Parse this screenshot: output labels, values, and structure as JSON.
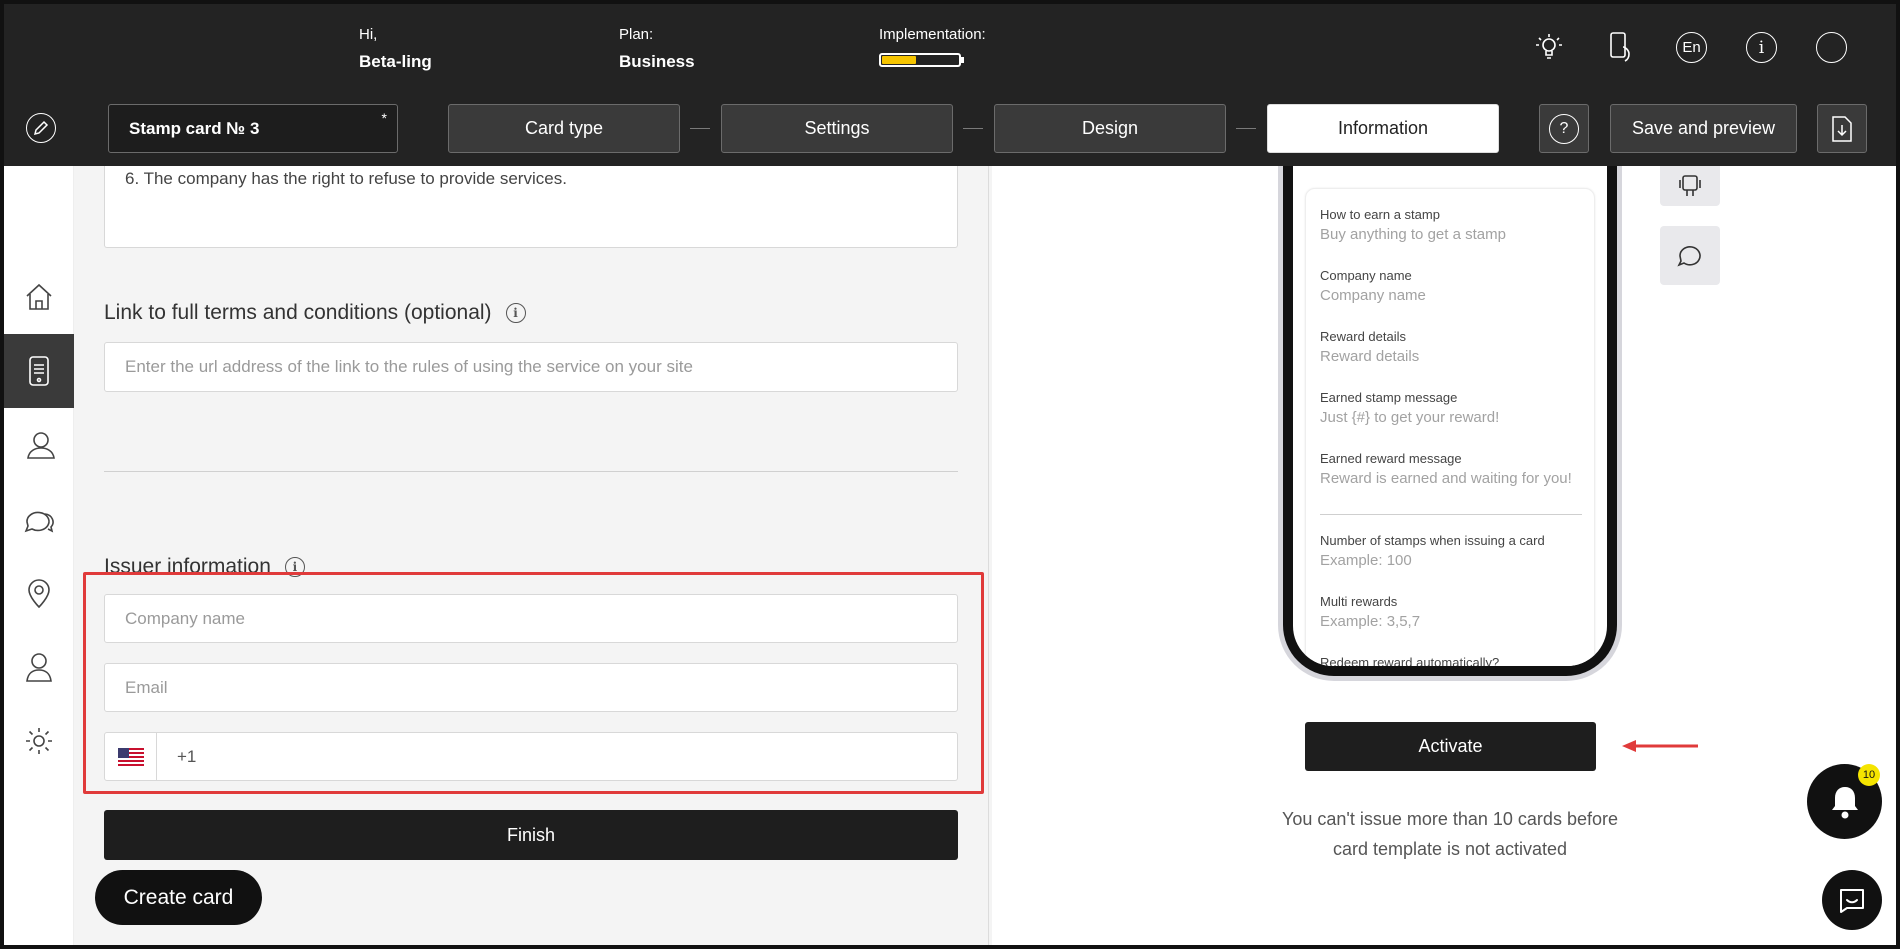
{
  "header": {
    "greeting": "Hi,",
    "user_name": "Beta-ling",
    "plan_label": "Plan:",
    "plan_value": "Business",
    "implementation_label": "Implementation:",
    "implementation_progress": 0.45,
    "language": "En",
    "icons": [
      "lightbulb-icon",
      "phone-touch-icon",
      "language-icon",
      "info-icon",
      "profile-circle-icon"
    ]
  },
  "toolbar": {
    "card_name": "Stamp card № 3",
    "unsaved_marker": "*",
    "steps": [
      "Card type",
      "Settings",
      "Design",
      "Information"
    ],
    "active_step": "Information",
    "save_preview": "Save and preview"
  },
  "sidebar": {
    "items": [
      "home-icon",
      "card-device-icon",
      "users-icon",
      "chat-icon",
      "location-icon",
      "profile-icon",
      "settings-icon"
    ],
    "active": "card-device-icon"
  },
  "form": {
    "terms_text": "6. The company has the right to refuse to provide services.",
    "link_heading": "Link to full terms and conditions (optional)",
    "link_placeholder": "Enter the url address of the link to the rules of using the service on your site",
    "issuer_heading": "Issuer information",
    "company_placeholder": "Company name",
    "email_placeholder": "Email",
    "phone_code": "+1",
    "finish_label": "Finish",
    "create_card_label": "Create card"
  },
  "preview": {
    "rows": [
      {
        "title": "How to earn a stamp",
        "value": "Buy anything to get a stamp"
      },
      {
        "title": "Company name",
        "value": "Company name"
      },
      {
        "title": "Reward details",
        "value": "Reward details"
      },
      {
        "title": "Earned stamp message",
        "value": "Just {#} to get your reward!"
      },
      {
        "title": "Earned reward message",
        "value": "Reward is earned and waiting for you!"
      },
      {
        "title": "Number of stamps when issuing a card",
        "value": "Example: 100"
      },
      {
        "title": "Multi rewards",
        "value": "Example: 3,5,7"
      },
      {
        "title": "Redeem reward automatically?",
        "value": ""
      }
    ],
    "activate_label": "Activate",
    "note_line1": "You can't issue more than 10 cards before",
    "note_line2": "card template is not activated"
  },
  "notifications": {
    "count": "10"
  },
  "colors": {
    "accent_yellow": "#f5c400",
    "highlight_red": "#e03a3a",
    "dark": "#232323"
  }
}
